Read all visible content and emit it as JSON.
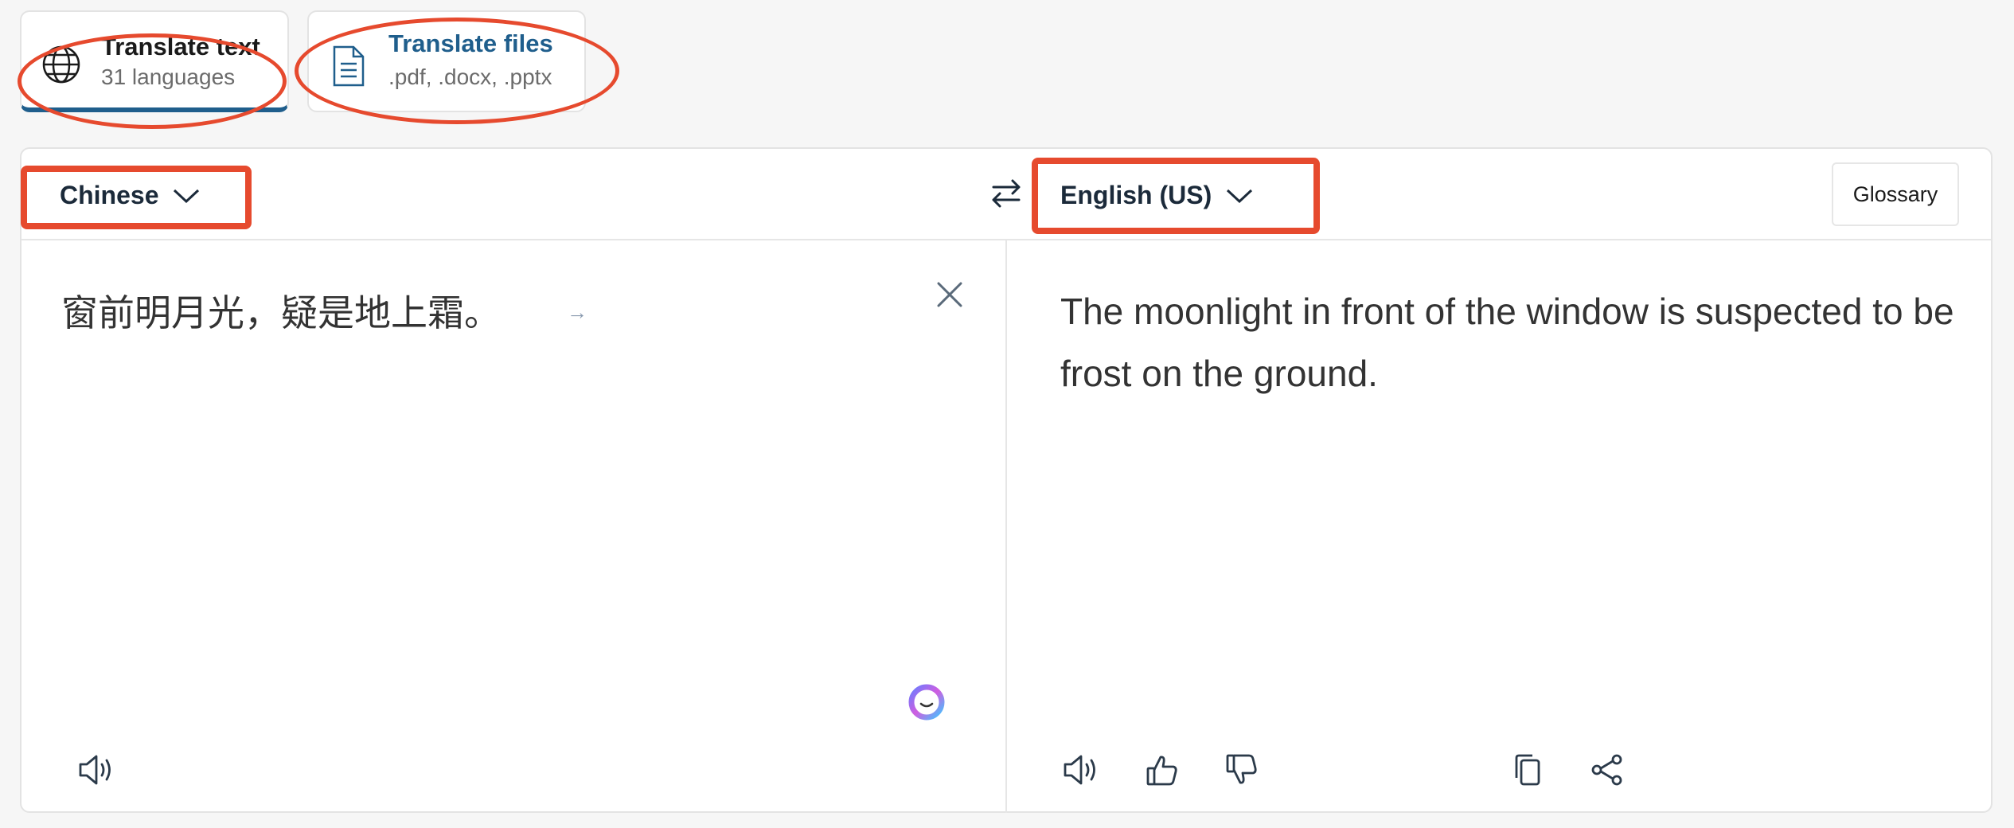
{
  "mode_tabs": {
    "text": {
      "title": "Translate text",
      "subtitle": "31 languages"
    },
    "files": {
      "title": "Translate files",
      "subtitle": ".pdf, .docx, .pptx"
    }
  },
  "toolbar": {
    "source_language": "Chinese",
    "target_language": "English (US)",
    "glossary_label": "Glossary"
  },
  "source": {
    "text": "窗前明月光，疑是地上霜。"
  },
  "target": {
    "text": "The moonlight in front of the window is suspected to be frost on the ground."
  },
  "icons": {
    "text_tab": "globe-icon",
    "files_tab": "document-icon",
    "swap": "swap-arrows-icon",
    "clear": "close-icon",
    "speak": "speaker-icon",
    "like": "thumbs-up-icon",
    "dislike": "thumbs-down-icon",
    "copy": "copy-icon",
    "share": "share-icon",
    "assistant": "assistant-face-icon"
  },
  "colors": {
    "accent": "#1f5e8c",
    "annotation": "#e64a2e"
  }
}
